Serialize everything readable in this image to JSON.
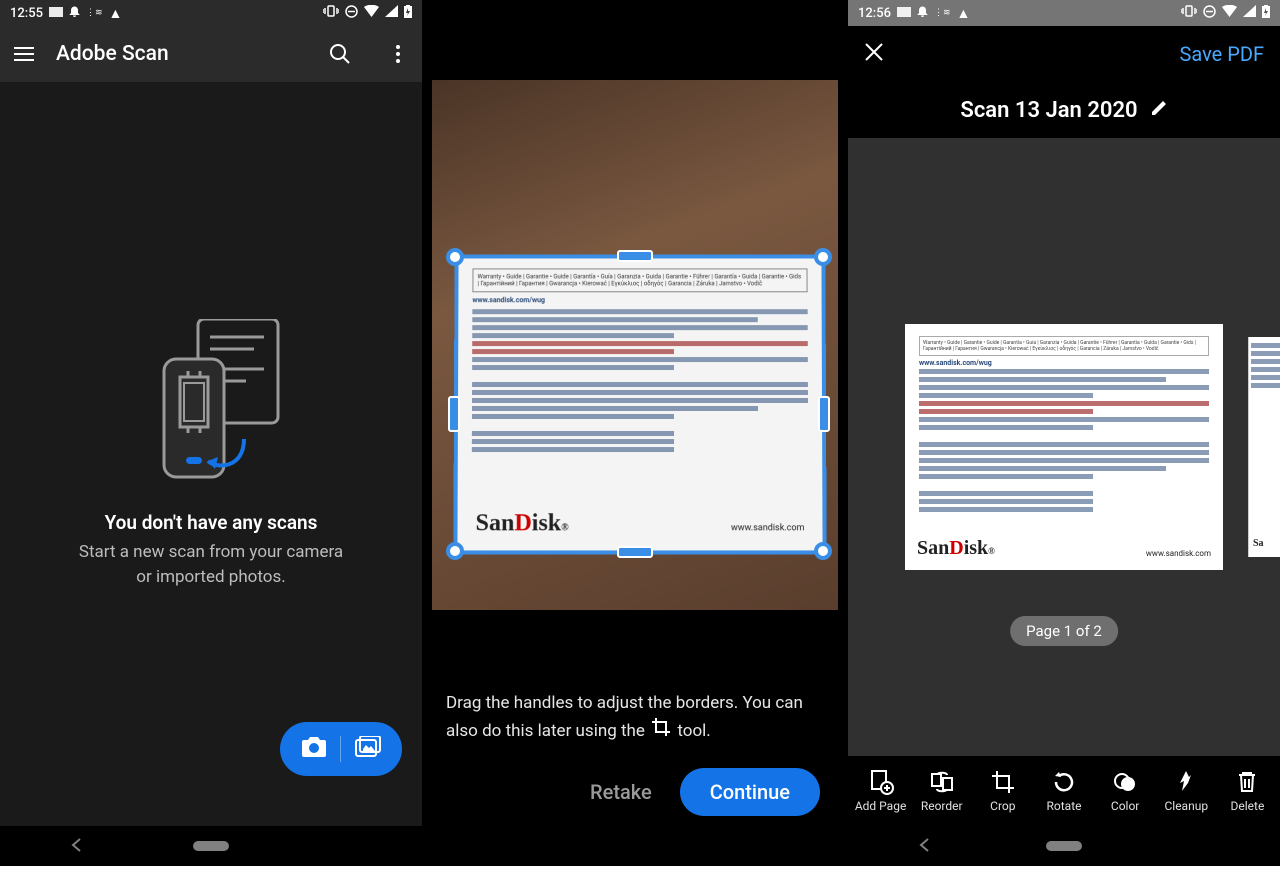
{
  "status": {
    "time_s1": "12:55",
    "time_s3": "12:56"
  },
  "screen1": {
    "app_title": "Adobe Scan",
    "empty_title": "You don't have any scans",
    "empty_sub_line1": "Start a new scan from your camera",
    "empty_sub_line2": "or imported photos."
  },
  "screen2": {
    "help_text_a": "Drag the handles to adjust the borders. You can also do this later using the",
    "help_text_b": "tool.",
    "retake": "Retake",
    "continue": "Continue",
    "card_brand": "SanDisk",
    "card_url": "www.sandisk.com",
    "card_wug": "www.sandisk.com/wug",
    "card_box_text": "Warranty • Guide | Garantie • Guide | Garantía • Guía | Garanzia • Guida | Garantie • Führer | Garantía • Guida | Garantie • Gids | Гарантійний | Гарантия | Gwarancja • Kierować | Εγκύκλιος | οδηγός | Garancia | Záruka | Jamstvo • Vodič"
  },
  "screen3": {
    "save_pdf": "Save PDF",
    "scan_title": "Scan 13 Jan 2020",
    "page_label": "Page 1 of 2",
    "tools": {
      "add_page": "Add Page",
      "reorder": "Reorder",
      "crop": "Crop",
      "rotate": "Rotate",
      "color": "Color",
      "cleanup": "Cleanup",
      "delete": "Delete"
    },
    "card_brand": "SanDisk",
    "card_url": "www.sandisk.com",
    "card_wug": "www.sandisk.com/wug"
  }
}
